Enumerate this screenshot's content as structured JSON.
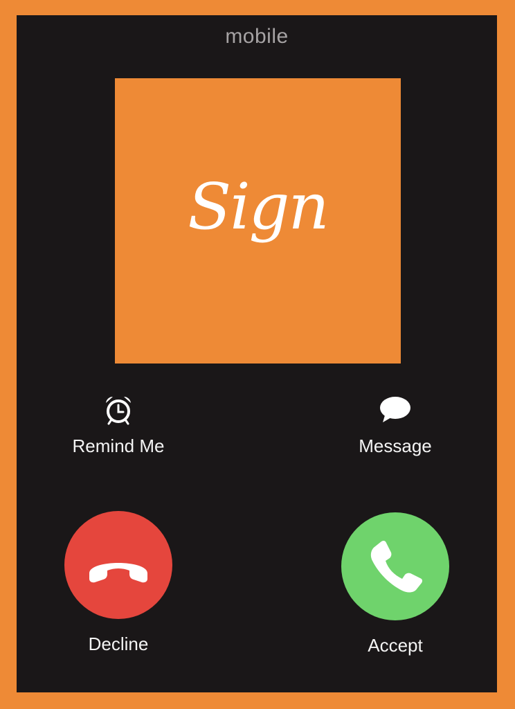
{
  "header": {
    "call_label": "mobile"
  },
  "caller": {
    "art_text": "Sign",
    "art_color": "#ee8a36"
  },
  "actions": {
    "remind_label": "Remind Me",
    "remind_icon": "alarm-clock-icon",
    "message_label": "Message",
    "message_icon": "speech-bubble-icon"
  },
  "buttons": {
    "decline_label": "Decline",
    "decline_icon": "phone-hangup-icon",
    "decline_color": "#e5463d",
    "accept_label": "Accept",
    "accept_icon": "phone-icon",
    "accept_color": "#6fd36c"
  },
  "theme": {
    "frame_color": "#ee8a36",
    "screen_color": "#1a1718"
  }
}
